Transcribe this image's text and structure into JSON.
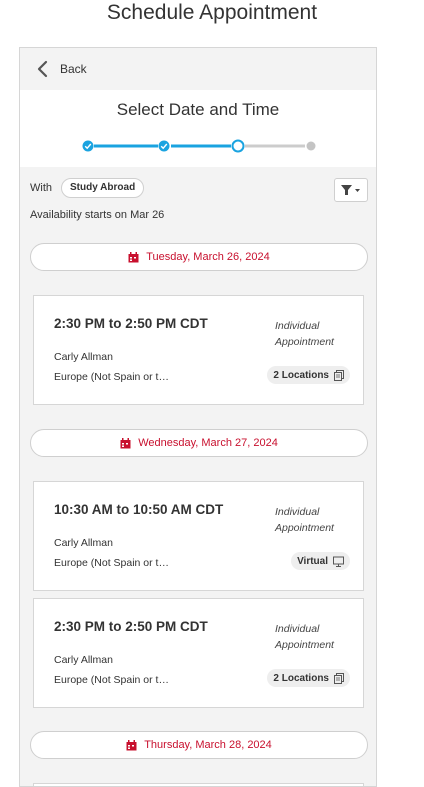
{
  "page_title": "Schedule Appointment",
  "back_label": "Back",
  "step_title": "Select Date and Time",
  "progress": {
    "total_steps": 4,
    "completed_steps": 2,
    "current_step": 3
  },
  "with_label": "With",
  "service_chip": "Study Abroad",
  "availability_text": "Availability starts on Mar 26",
  "colors": {
    "accent": "#1aa3e0",
    "date_red": "#c8102e"
  },
  "days": [
    {
      "date": "Tuesday, March 26, 2024",
      "slots": [
        {
          "time": "2:30 PM to 2:50 PM CDT",
          "type": "Individual Appointment",
          "advisor": "Carly Allman",
          "location": "Europe (Not Spain or t…",
          "badge": "2 Locations",
          "badge_icon": "copy-icon"
        }
      ]
    },
    {
      "date": "Wednesday, March 27, 2024",
      "slots": [
        {
          "time": "10:30 AM to 10:50 AM CDT",
          "type": "Individual Appointment",
          "advisor": "Carly Allman",
          "location": "Europe (Not Spain or t…",
          "badge": "Virtual",
          "badge_icon": "monitor-icon"
        },
        {
          "time": "2:30 PM to 2:50 PM CDT",
          "type": "Individual Appointment",
          "advisor": "Carly Allman",
          "location": "Europe (Not Spain or t…",
          "badge": "2 Locations",
          "badge_icon": "copy-icon"
        }
      ]
    },
    {
      "date": "Thursday, March 28, 2024",
      "slots": []
    }
  ]
}
